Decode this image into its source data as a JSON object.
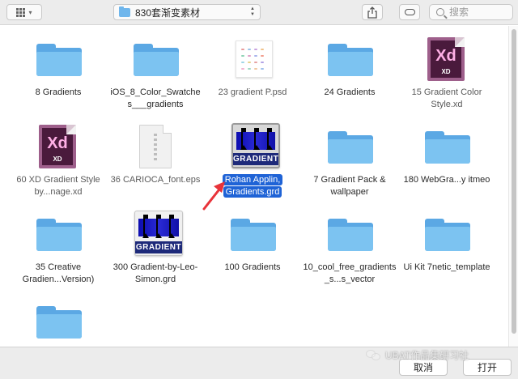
{
  "toolbar": {
    "path_label": "830套渐变素材",
    "search_placeholder": "搜索"
  },
  "items": [
    {
      "label": "8 Gradients",
      "kind": "folder"
    },
    {
      "label": "iOS_8_Color_Swatches___gradients",
      "kind": "folder"
    },
    {
      "label": "23 gradient P.psd",
      "kind": "psd"
    },
    {
      "label": "24 Gradients",
      "kind": "folder"
    },
    {
      "label": "15 Gradient Color Style.xd",
      "kind": "xd"
    },
    {
      "label": "60 XD Gradient Style by...nage.xd",
      "kind": "xd"
    },
    {
      "label": "36 CARIOCA_font.eps",
      "kind": "eps"
    },
    {
      "label": "Rohan Applin, Gradients.grd",
      "kind": "grd",
      "selected": true
    },
    {
      "label": "7 Gradient Pack & wallpaper",
      "kind": "folder"
    },
    {
      "label": "180 WebGra...y itmeo",
      "kind": "folder"
    },
    {
      "label": "35 Creative Gradien...Version)",
      "kind": "folder"
    },
    {
      "label": "300 Gradient-by-Leo-Simon.grd",
      "kind": "grd"
    },
    {
      "label": "100 Gradients",
      "kind": "folder"
    },
    {
      "label": "10_cool_free_gradients_s...s_vector",
      "kind": "folder"
    },
    {
      "label": "Ui Kit 7netic_template",
      "kind": "folder"
    },
    {
      "label": "",
      "kind": "folder"
    }
  ],
  "icons": {
    "xd_text": "Xd",
    "xd_sub": "XD",
    "grd_text": "GRADIENT"
  },
  "buttons": {
    "cancel": "取消",
    "open": "打开"
  },
  "watermark": "UBAT作品集研习社",
  "colors": {
    "selection": "#1f63d6",
    "folder": "#7cc3f1",
    "arrow": "#e8333a"
  }
}
